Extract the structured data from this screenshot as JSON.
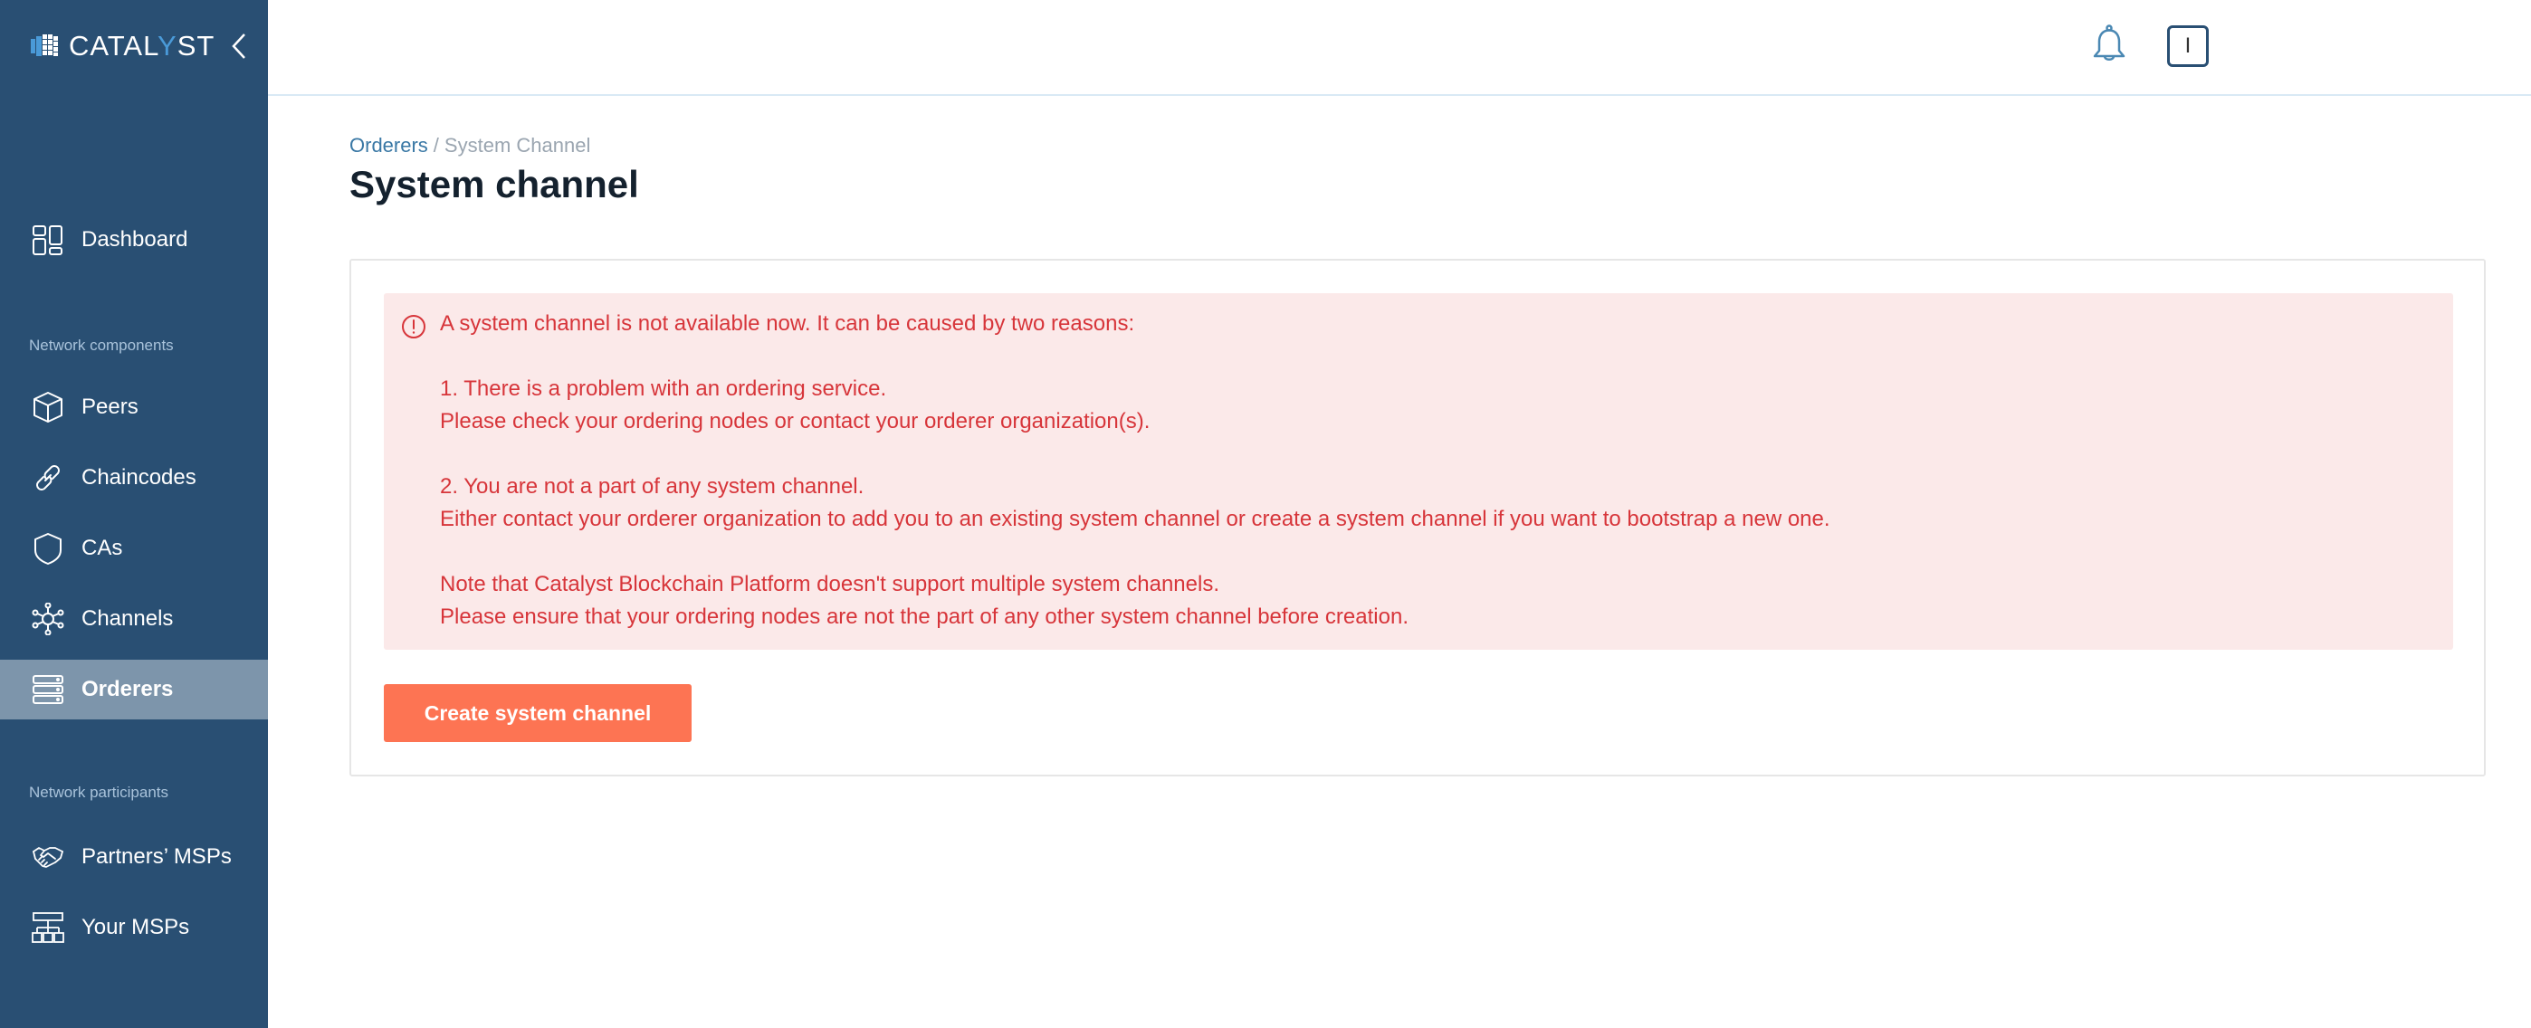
{
  "app": {
    "logo_prefix": "CATAL",
    "logo_y": "Y",
    "logo_suffix": "ST"
  },
  "sidebar": {
    "items_top": [
      {
        "label": "Dashboard",
        "icon": "dashboard-icon"
      }
    ],
    "section_components": "Network components",
    "items_components": [
      {
        "label": "Peers",
        "icon": "cube-icon"
      },
      {
        "label": "Chaincodes",
        "icon": "link-icon"
      },
      {
        "label": "CAs",
        "icon": "shield-icon"
      },
      {
        "label": "Channels",
        "icon": "network-icon"
      },
      {
        "label": "Orderers",
        "icon": "server-icon",
        "active": true
      }
    ],
    "section_participants": "Network participants",
    "items_participants": [
      {
        "label": "Partners’ MSPs",
        "icon": "handshake-icon"
      },
      {
        "label": "Your MSPs",
        "icon": "org-chart-icon"
      }
    ]
  },
  "topbar": {
    "notifications_icon": "bell-icon",
    "avatar_initial": "I"
  },
  "breadcrumb": {
    "parent": "Orderers",
    "separator": "/",
    "current": "System Channel"
  },
  "page": {
    "title": "System channel"
  },
  "alert": {
    "icon": "exclamation-circle-icon",
    "intro": "A system channel is not available now. It can be caused by two reasons:",
    "reason1_title": "1. There is a problem with an ordering service.",
    "reason1_detail": "Please check your ordering nodes or contact your orderer organization(s).",
    "reason2_title": "2. You are not a part of any system channel.",
    "reason2_detail": "Either contact your orderer organization to add you to an existing system channel or create a system channel if you want to bootstrap a new one.",
    "note1": "Note that Catalyst Blockchain Platform doesn't support multiple system channels.",
    "note2": "Please ensure that your ordering nodes are not the part of any other system channel before creation."
  },
  "actions": {
    "create_label": "Create system channel"
  },
  "colors": {
    "sidebar_bg": "#294f73",
    "sidebar_active": "#7d95ab",
    "alert_bg": "#fbe9e9",
    "alert_text": "#d7353a",
    "primary_button": "#fd7453",
    "link": "#3a78a5"
  }
}
